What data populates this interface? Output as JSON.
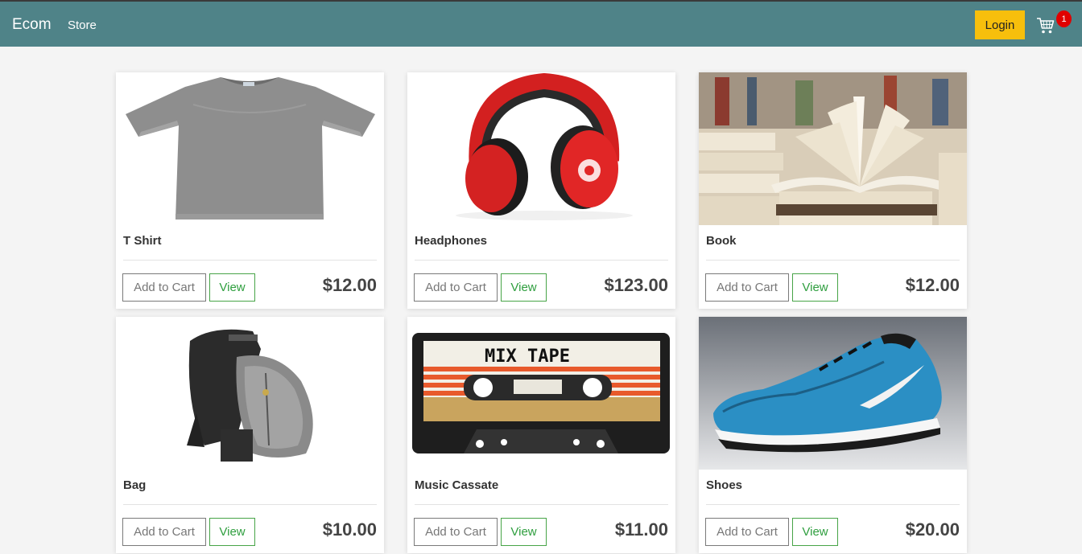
{
  "nav": {
    "brand": "Ecom",
    "store_link": "Store",
    "login_label": "Login",
    "cart_count": "1"
  },
  "colors": {
    "navbar": "#4f8388",
    "login": "#f7bf0c",
    "view_button": "#2e9e3e",
    "badge": "#e00000"
  },
  "products": [
    {
      "name": "T Shirt",
      "price": "$12.00",
      "add_label": "Add to Cart",
      "view_label": "View",
      "image": "gray-tshirt"
    },
    {
      "name": "Headphones",
      "price": "$123.00",
      "add_label": "Add to Cart",
      "view_label": "View",
      "image": "red-headphones"
    },
    {
      "name": "Book",
      "price": "$12.00",
      "add_label": "Add to Cart",
      "view_label": "View",
      "image": "open-book"
    },
    {
      "name": "Bag",
      "price": "$10.00",
      "add_label": "Add to Cart",
      "view_label": "View",
      "image": "backpack"
    },
    {
      "name": "Music Cassate",
      "price": "$11.00",
      "add_label": "Add to Cart",
      "view_label": "View",
      "image": "cassette-tape",
      "image_text": "MIX TAPE"
    },
    {
      "name": "Shoes",
      "price": "$20.00",
      "add_label": "Add to Cart",
      "view_label": "View",
      "image": "blue-sneaker"
    }
  ]
}
